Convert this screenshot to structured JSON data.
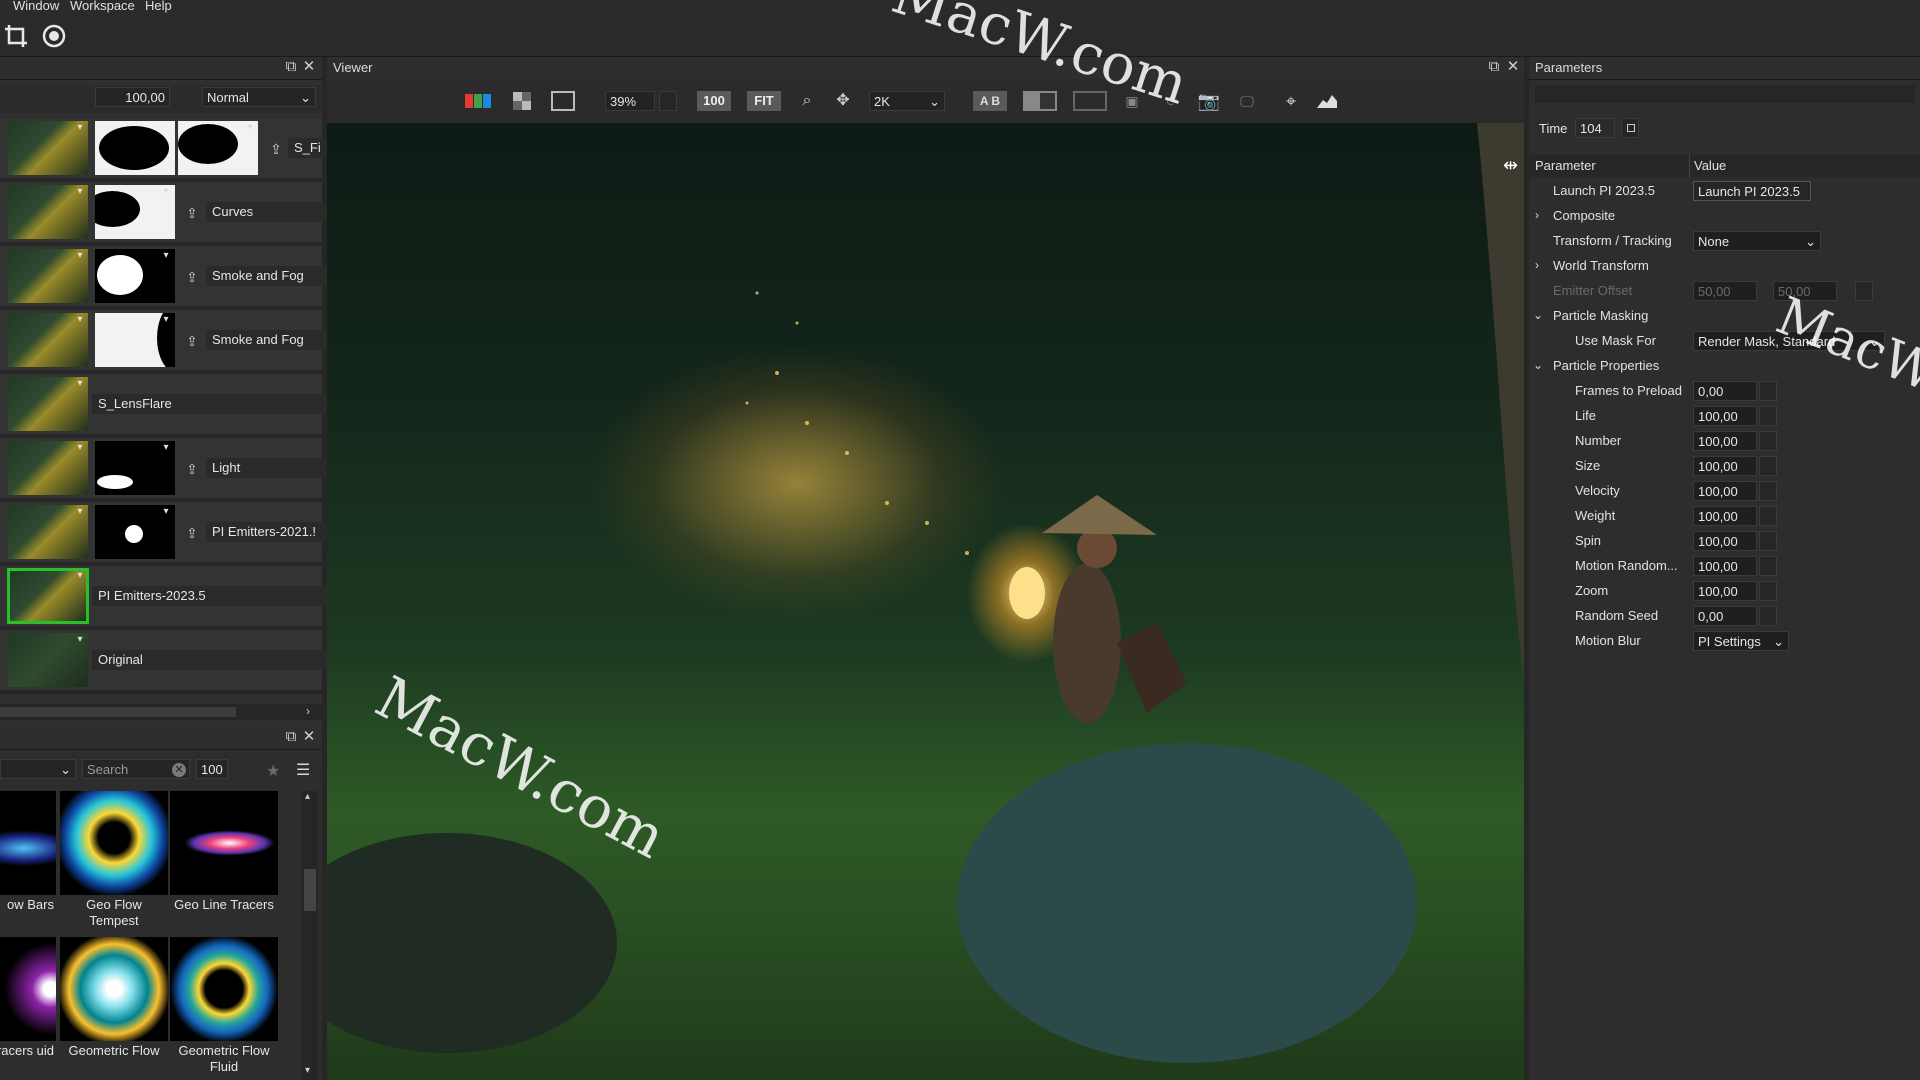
{
  "menu": {
    "items": [
      "Window",
      "Workspace",
      "Help"
    ]
  },
  "toolbar": {
    "icons": [
      "crop-icon",
      "target-icon"
    ]
  },
  "layers_panel": {
    "opacity_value": "100,00",
    "blend_mode": "Normal",
    "layers": [
      {
        "name": "S_Fi"
      },
      {
        "name": "Curves"
      },
      {
        "name": "Smoke and Fog"
      },
      {
        "name": "Smoke and Fog"
      },
      {
        "name": "S_LensFlare"
      },
      {
        "name": "Light"
      },
      {
        "name": "PI Emitters-2021.!"
      },
      {
        "name": "PI Emitters-2023.5"
      },
      {
        "name": "Original"
      }
    ]
  },
  "presets_panel": {
    "search_placeholder": "Search",
    "count_value": "100",
    "presets": [
      {
        "label": "ow Bars"
      },
      {
        "label": "Geo Flow Tempest"
      },
      {
        "label": "Geo Line Tracers"
      },
      {
        "label": "e Tracers uid"
      },
      {
        "label": "Geometric Flow"
      },
      {
        "label": "Geometric Flow Fluid"
      }
    ]
  },
  "viewer": {
    "title": "Viewer",
    "zoom": "39%",
    "btn_100": "100",
    "btn_fit": "FIT",
    "resolution": "2K",
    "ab_label": "A B",
    "watermark": "MacW.com"
  },
  "parameters": {
    "title": "Parameters",
    "time_label": "Time",
    "time_value": "104",
    "col_parameter": "Parameter",
    "col_value": "Value",
    "rows": {
      "launch": {
        "label": "Launch PI 2023.5",
        "value": "Launch PI 2023.5"
      },
      "composite": {
        "label": "Composite"
      },
      "transform": {
        "label": "Transform / Tracking",
        "value": "None"
      },
      "world": {
        "label": "World Transform"
      },
      "emitter": {
        "label": "Emitter Offset",
        "x": "50,00",
        "y": "50,00"
      },
      "masking": {
        "label": "Particle Masking"
      },
      "usemask": {
        "label": "Use Mask For",
        "value": "Render Mask, Standard"
      },
      "props": {
        "label": "Particle Properties"
      },
      "preload": {
        "label": "Frames to Preload",
        "value": "0,00"
      },
      "life": {
        "label": "Life",
        "value": "100,00"
      },
      "number": {
        "label": "Number",
        "value": "100,00"
      },
      "size": {
        "label": "Size",
        "value": "100,00"
      },
      "velocity": {
        "label": "Velocity",
        "value": "100,00"
      },
      "weight": {
        "label": "Weight",
        "value": "100,00"
      },
      "spin": {
        "label": "Spin",
        "value": "100,00"
      },
      "motionrandom": {
        "label": "Motion Random...",
        "value": "100,00"
      },
      "zoom": {
        "label": "Zoom",
        "value": "100,00"
      },
      "seed": {
        "label": "Random Seed",
        "value": "0,00"
      },
      "motionblur": {
        "label": "Motion Blur",
        "value": "PI Settings"
      }
    }
  },
  "colors": {
    "selection": "#28c028",
    "panel": "#2d2d2d",
    "background": "#262626"
  }
}
